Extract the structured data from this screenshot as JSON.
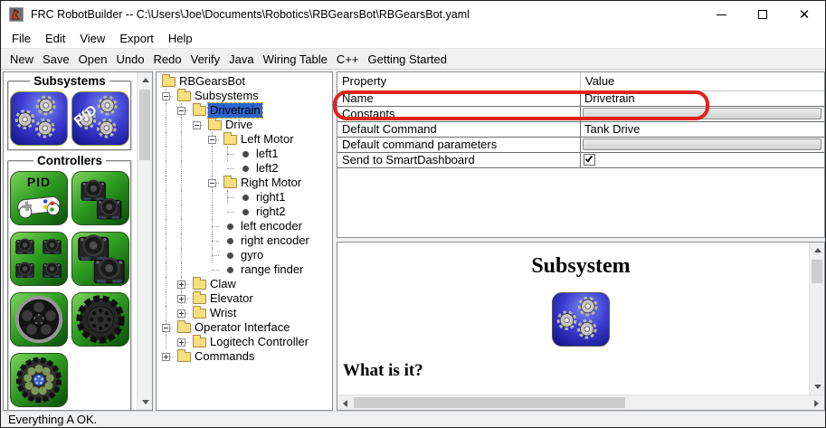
{
  "window": {
    "title": "FRC RobotBuilder -- C:\\Users\\Joe\\Documents\\Robotics\\RBGearsBot\\RBGearsBot.yaml",
    "controls": {
      "minimize": "minimize",
      "maximize": "maximize",
      "close": "close"
    }
  },
  "menu_bar": {
    "items": [
      "File",
      "Edit",
      "View",
      "Export",
      "Help"
    ]
  },
  "toolbar": {
    "items": [
      "New",
      "Save",
      "Open",
      "Undo",
      "Redo",
      "Verify",
      "Java",
      "Wiring Table",
      "C++",
      "Getting Started"
    ]
  },
  "palette": {
    "groups": [
      {
        "title": "Subsystems",
        "items": [
          {
            "name": "subsystem",
            "icon": "gears-icon",
            "tile": "blue"
          },
          {
            "name": "pid-subsystem",
            "icon": "gears-icon",
            "tile": "blue",
            "overlay": "PID",
            "overlay_style": "diagonal"
          }
        ]
      },
      {
        "title": "Controllers",
        "items": [
          {
            "name": "pid-controller",
            "icon": "gamepad-icon",
            "tile": "green",
            "overlay": "PID",
            "overlay_style": "top"
          },
          {
            "name": "motor-controller-pair",
            "icon": "motor-controller-icon",
            "tile": "green"
          },
          {
            "name": "motor-controller-quad",
            "icon": "motor-controller-icon",
            "tile": "green"
          },
          {
            "name": "motor-controller-pair-large",
            "icon": "motor-controller-icon",
            "tile": "green"
          },
          {
            "name": "wheel",
            "icon": "wheel-icon",
            "tile": "green"
          },
          {
            "name": "omni-wheel",
            "icon": "omni-wheel-icon",
            "tile": "green"
          },
          {
            "name": "mecanum-wheel",
            "icon": "mecanum-wheel-icon",
            "tile": "green"
          }
        ]
      }
    ]
  },
  "tree": {
    "nodes": [
      {
        "label": "RBGearsBot",
        "level": 0,
        "icon": "folder",
        "toggle": "none",
        "selected": false
      },
      {
        "label": "Subsystems",
        "level": 1,
        "icon": "folder",
        "toggle": "minus",
        "selected": false
      },
      {
        "label": "Drivetrain",
        "level": 2,
        "icon": "folder",
        "toggle": "minus",
        "selected": true
      },
      {
        "label": "Drive",
        "level": 3,
        "icon": "folder",
        "toggle": "minus",
        "selected": false
      },
      {
        "label": "Left Motor",
        "level": 4,
        "icon": "folder",
        "toggle": "minus",
        "selected": false
      },
      {
        "label": "left1",
        "level": 5,
        "icon": "bullet",
        "toggle": "none",
        "selected": false
      },
      {
        "label": "left2",
        "level": 5,
        "icon": "bullet",
        "toggle": "none",
        "selected": false
      },
      {
        "label": "Right Motor",
        "level": 4,
        "icon": "folder",
        "toggle": "minus",
        "selected": false
      },
      {
        "label": "right1",
        "level": 5,
        "icon": "bullet",
        "toggle": "none",
        "selected": false
      },
      {
        "label": "right2",
        "level": 5,
        "icon": "bullet",
        "toggle": "none",
        "selected": false
      },
      {
        "label": "left encoder",
        "level": 4,
        "icon": "bullet",
        "toggle": "none",
        "selected": false
      },
      {
        "label": "right encoder",
        "level": 4,
        "icon": "bullet",
        "toggle": "none",
        "selected": false
      },
      {
        "label": "gyro",
        "level": 4,
        "icon": "bullet",
        "toggle": "none",
        "selected": false
      },
      {
        "label": "range finder",
        "level": 4,
        "icon": "bullet",
        "toggle": "none",
        "selected": false
      },
      {
        "label": "Claw",
        "level": 2,
        "icon": "folder",
        "toggle": "plus",
        "selected": false
      },
      {
        "label": "Elevator",
        "level": 2,
        "icon": "folder",
        "toggle": "plus",
        "selected": false
      },
      {
        "label": "Wrist",
        "level": 2,
        "icon": "folder",
        "toggle": "plus",
        "selected": false
      },
      {
        "label": "Operator Interface",
        "level": 1,
        "icon": "folder",
        "toggle": "minus",
        "selected": false
      },
      {
        "label": "Logitech Controller",
        "level": 2,
        "icon": "folder",
        "toggle": "plus",
        "selected": false
      },
      {
        "label": "Commands",
        "level": 1,
        "icon": "folder",
        "toggle": "plus",
        "selected": false
      }
    ]
  },
  "properties": {
    "columns": [
      "Property",
      "Value"
    ],
    "rows": [
      {
        "property": "Name",
        "value": "Drivetrain",
        "type": "text",
        "annotated": true
      },
      {
        "property": "Constants",
        "value": "",
        "type": "button",
        "annotated": false
      },
      {
        "property": "Default Command",
        "value": "Tank Drive",
        "type": "text",
        "annotated": false
      },
      {
        "property": "Default command parameters",
        "value": "",
        "type": "button",
        "annotated": false
      },
      {
        "property": "Send to SmartDashboard",
        "value": "checked",
        "type": "checkbox",
        "annotated": false
      }
    ]
  },
  "help": {
    "title": "Subsystem",
    "icon": "subsystem",
    "section_heading": "What is it?"
  },
  "status_bar": {
    "text": "Everything A OK."
  },
  "annotation": {
    "shape": "rounded-rectangle",
    "color": "#e2231a",
    "target": "Name = Drivetrain row"
  },
  "colors": {
    "annotation_red": "#e2231a",
    "tree_selection": "#2e65cf",
    "folder_yellow": "#f7df7f",
    "tile_blue": "#2525b8",
    "tile_green": "#1d7a14"
  }
}
